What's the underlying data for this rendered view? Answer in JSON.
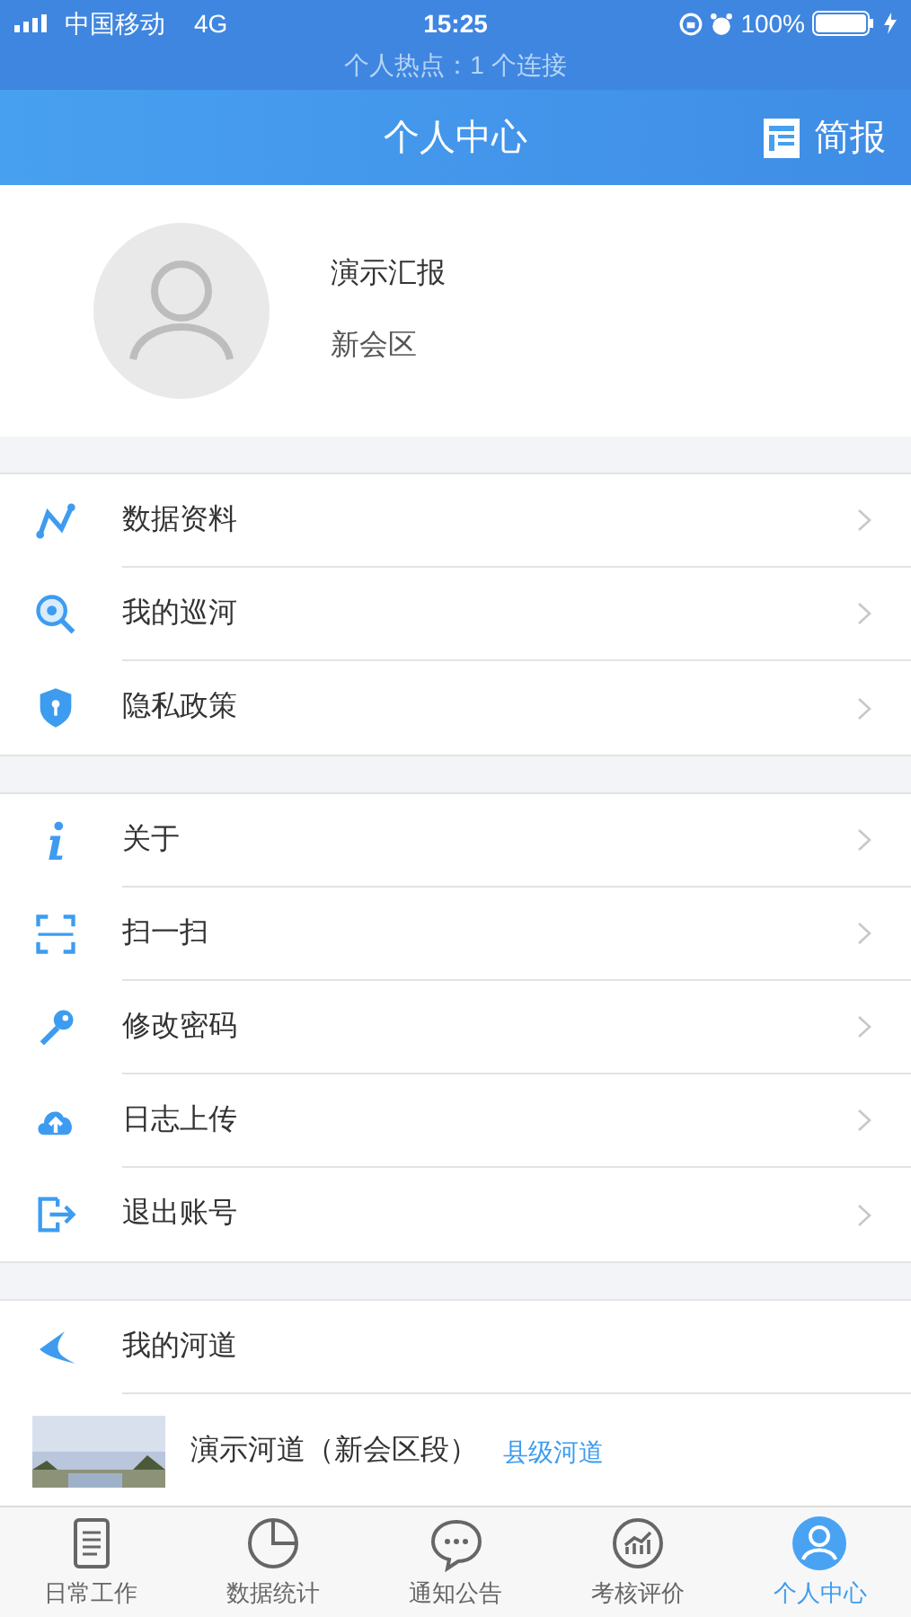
{
  "status_bar": {
    "carrier": "中国移动",
    "network": "4G",
    "time": "15:25",
    "battery": "100%",
    "hotspot": "个人热点：1 个连接"
  },
  "nav": {
    "title": "个人中心",
    "action": "简报"
  },
  "profile": {
    "name": "演示汇报",
    "region": "新会区"
  },
  "menu_groups": [
    [
      {
        "label": "数据资料",
        "kind": "chart"
      },
      {
        "label": "我的巡河",
        "kind": "eye"
      },
      {
        "label": "隐私政策",
        "kind": "shield"
      }
    ],
    [
      {
        "label": "关于",
        "kind": "info"
      },
      {
        "label": "扫一扫",
        "kind": "scan"
      },
      {
        "label": "修改密码",
        "kind": "key"
      },
      {
        "label": "日志上传",
        "kind": "upload"
      },
      {
        "label": "退出账号",
        "kind": "logout"
      }
    ]
  ],
  "rivers": {
    "title": "我的河道",
    "items": [
      {
        "name": "演示河道（新会区段）",
        "level": "县级河道",
        "kind": "picture"
      }
    ]
  },
  "tabs": [
    {
      "label": "日常工作",
      "kind": "doc",
      "selected": false
    },
    {
      "label": "数据统计",
      "kind": "pie",
      "selected": false
    },
    {
      "label": "通知公告",
      "kind": "chat",
      "selected": false
    },
    {
      "label": "考核评价",
      "kind": "trend",
      "selected": false
    },
    {
      "label": "个人中心",
      "kind": "user",
      "selected": true
    }
  ]
}
